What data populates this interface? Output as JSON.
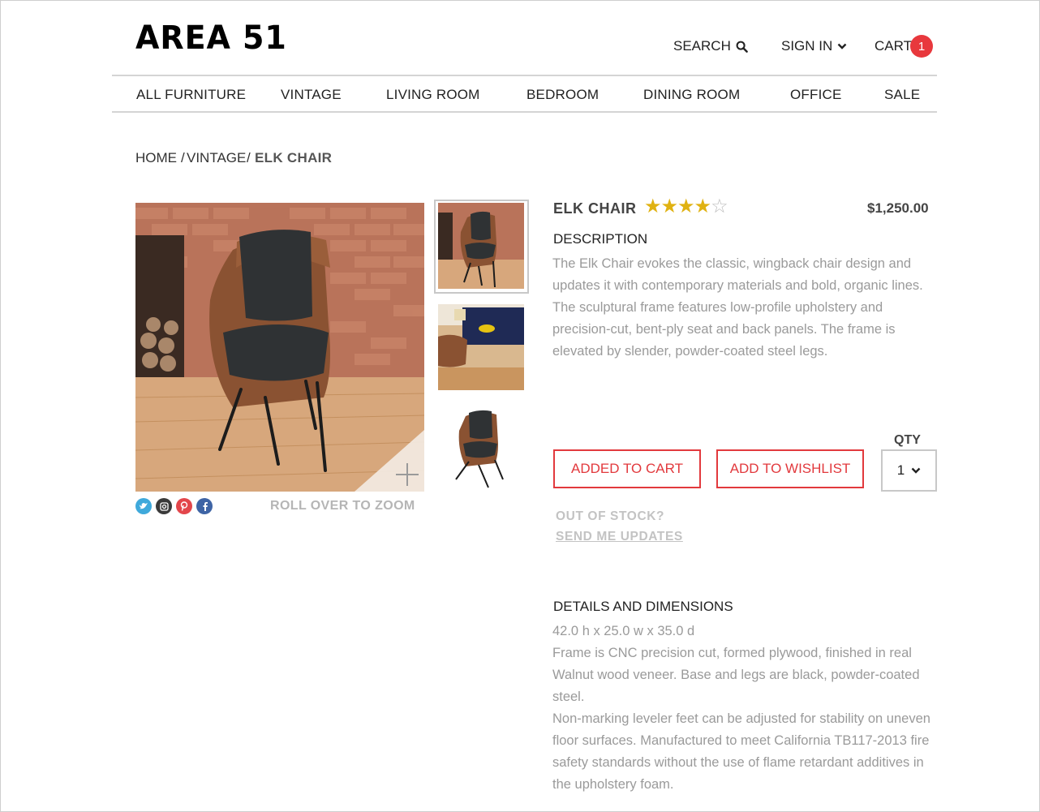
{
  "brand": {
    "logo": "AREA 51"
  },
  "header": {
    "search_label": "SEARCH",
    "signin_label": "SIGN IN",
    "cart_label": "CART",
    "cart_count": "1"
  },
  "nav": {
    "items": [
      "ALL FURNITURE",
      "VINTAGE",
      "LIVING ROOM",
      "BEDROOM",
      "DINING ROOM",
      "OFFICE",
      "SALE"
    ]
  },
  "breadcrumb": {
    "home": "HOME",
    "sep1": "/",
    "section": "VINTAGE",
    "sep2": "/",
    "current": "ELK CHAIR"
  },
  "gallery": {
    "zoom_hint": "ROLL OVER TO ZOOM",
    "social": [
      "twitter-icon",
      "instagram-icon",
      "pinterest-icon",
      "facebook-icon"
    ]
  },
  "product": {
    "name": "ELK CHAIR",
    "rating": 4,
    "rating_max": 5,
    "price": "$1,250.00",
    "description_title": "DESCRIPTION",
    "description": "The Elk Chair evokes the classic, wingback chair design and updates it with contemporary materials and bold, organic lines. The sculptural frame features low-profile upholstery and precision-cut, bent-ply seat and back panels.  The frame is elevated by slender, powder-coated steel legs.",
    "added_to_cart_label": "ADDED TO CART",
    "wishlist_label": "ADD TO WISHLIST",
    "qty_label": "QTY",
    "qty_value": "1",
    "out_of_stock": "OUT OF STOCK?",
    "send_updates": "SEND ME UPDATES",
    "details_title": "DETAILS AND DIMENSIONS",
    "dimensions": "42.0 h x 25.0 w x 35.0 d",
    "details_1": "Frame is CNC precision cut, formed plywood, finished in real Walnut wood veneer. Base and legs are black, powder-coated steel.",
    "details_2": "Non-marking leveler feet can be adjusted for stability on uneven floor surfaces. Manufactured to meet California TB117-2013 fire safety standards without the use of flame retardant additives in the upholstery foam."
  },
  "colors": {
    "accent": "#e2393d",
    "star": "#e0b212",
    "muted_text": "#9a9a9a"
  }
}
